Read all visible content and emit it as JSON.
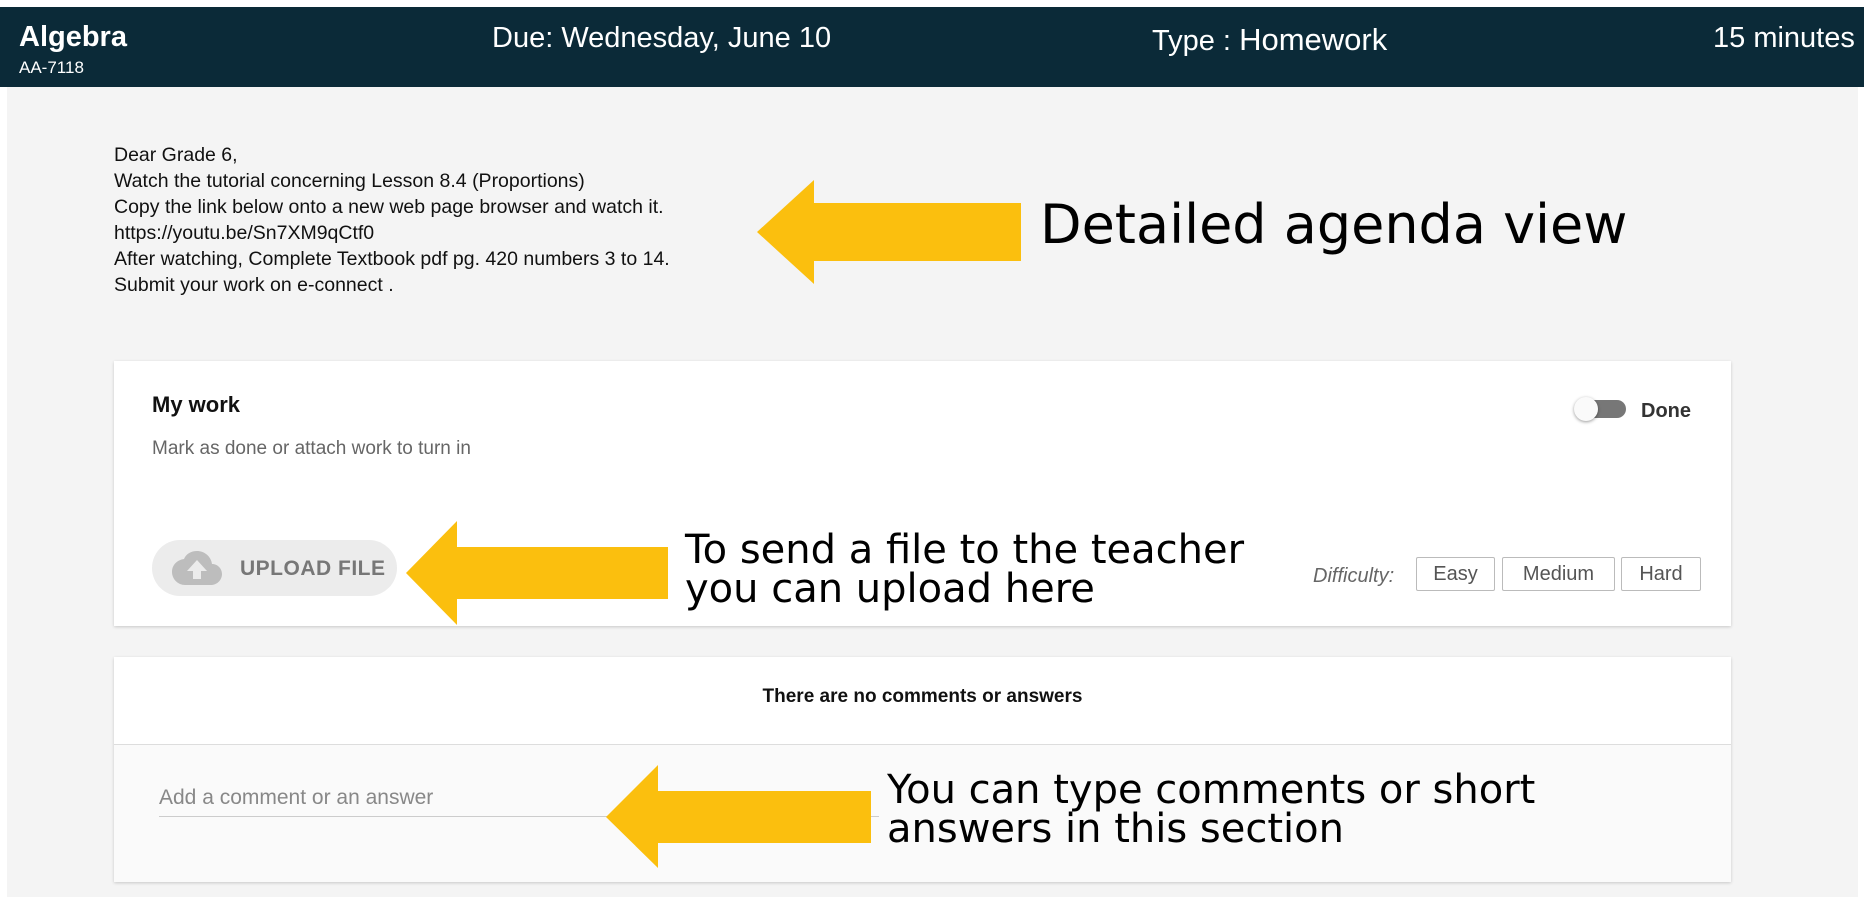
{
  "header": {
    "course_title": "Algebra",
    "course_code": "AA-7118",
    "due": "Due: Wednesday, June 10",
    "type_label": "Type :",
    "type_value": "Homework",
    "duration": "15 minutes"
  },
  "message": {
    "lines": [
      "Dear Grade 6,",
      "Watch the tutorial concerning Lesson 8.4 (Proportions)",
      "Copy the link below onto a new web page browser and watch it.",
      "https://youtu.be/Sn7XM9qCtf0",
      "After watching, Complete Textbook pdf pg. 420 numbers 3 to 14.",
      "Submit your work on e-connect ."
    ]
  },
  "callouts": {
    "agenda": "Detailed agenda view",
    "upload_line1": "To send a file to the teacher",
    "upload_line2": "you can upload here",
    "comment_line1": "You can type comments or short",
    "comment_line2": "answers in this section"
  },
  "my_work": {
    "title": "My work",
    "subtitle": "Mark as done or attach work to turn in",
    "done_label": "Done",
    "done_checked": false,
    "upload_label": "UPLOAD FILE",
    "upload_icon": "cloud-upload-icon",
    "difficulty_label": "Difficulty:",
    "difficulty_options": [
      "Easy",
      "Medium",
      "Hard"
    ]
  },
  "comments": {
    "empty_message": "There are no comments or answers",
    "input_placeholder": "Add a comment or an answer"
  },
  "colors": {
    "header_bg": "#0b2a38",
    "page_bg": "#f4f4f4",
    "arrow": "#fbbf0e"
  }
}
